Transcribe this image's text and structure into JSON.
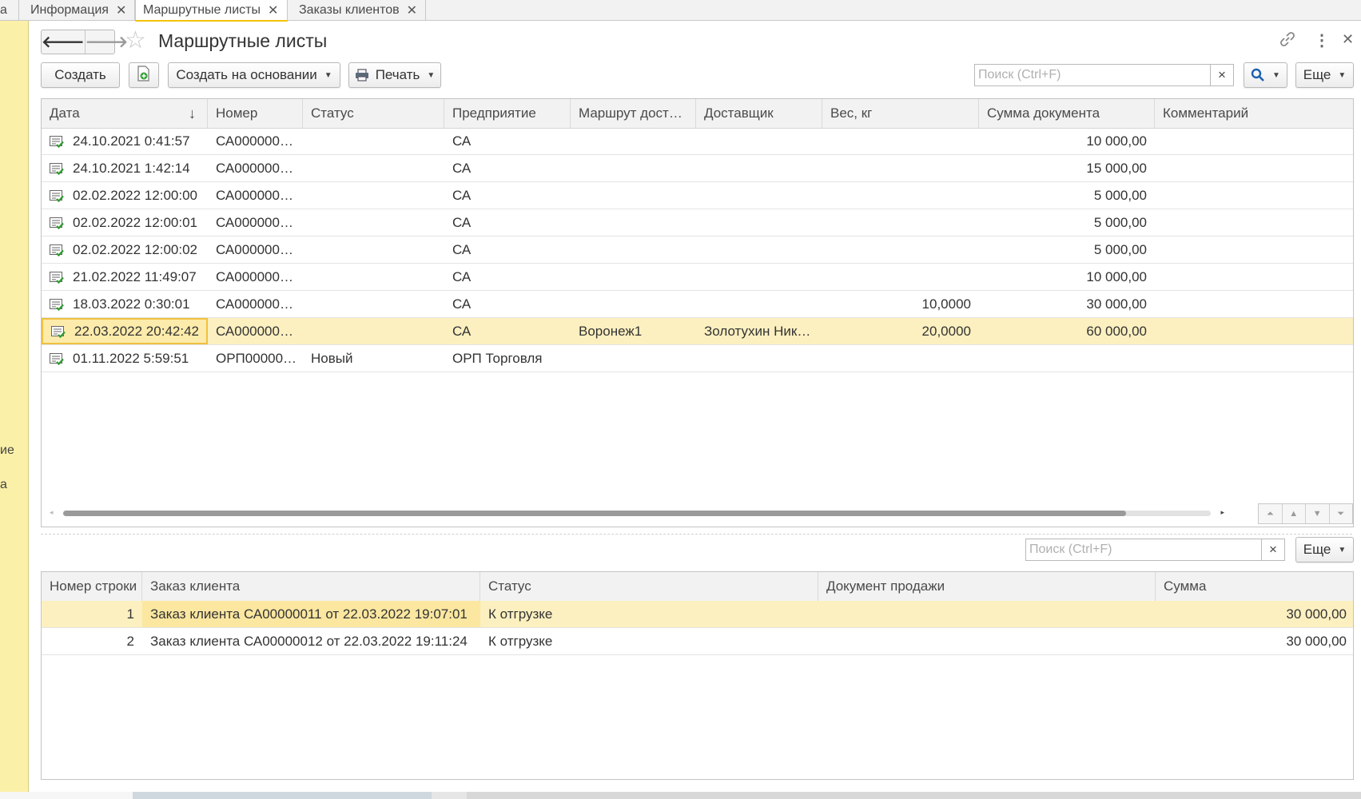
{
  "tabs": [
    {
      "label": "а",
      "closable": false
    },
    {
      "label": "Информация",
      "closable": true
    },
    {
      "label": "Маршрутные листы",
      "closable": true,
      "active": true
    },
    {
      "label": "Заказы клиентов",
      "closable": true
    }
  ],
  "left_panel": {
    "item1": "ие",
    "item2": "а"
  },
  "header": {
    "title": "Маршрутные листы",
    "back_icon": "arrow-left-icon",
    "forward_icon": "arrow-right-icon",
    "favorite_icon": "star-icon",
    "link_icon": "link-icon",
    "menu_icon": "kebab-menu-icon",
    "close_icon": "close-icon"
  },
  "toolbar": {
    "create_label": "Создать",
    "copy_icon": "add-document-icon",
    "create_based_label": "Создать на основании",
    "print_label": "Печать",
    "search_placeholder": "Поиск (Ctrl+F)",
    "search_clear": "×",
    "more_label": "Еще"
  },
  "main_table": {
    "columns": [
      "Дата",
      "Номер",
      "Статус",
      "Предприятие",
      "Маршрут дост…",
      "Доставщик",
      "Вес, кг",
      "Сумма документа",
      "Комментарий"
    ],
    "sort_icon": "↓",
    "rows": [
      {
        "date": "24.10.2021 0:41:57",
        "number": "СА000000…",
        "status": "",
        "company": "СА",
        "route": "",
        "courier": "",
        "weight": "",
        "sum": "10 000,00",
        "comment": ""
      },
      {
        "date": "24.10.2021 1:42:14",
        "number": "СА000000…",
        "status": "",
        "company": "СА",
        "route": "",
        "courier": "",
        "weight": "",
        "sum": "15 000,00",
        "comment": ""
      },
      {
        "date": "02.02.2022 12:00:00",
        "number": "СА000000…",
        "status": "",
        "company": "СА",
        "route": "",
        "courier": "",
        "weight": "",
        "sum": "5 000,00",
        "comment": ""
      },
      {
        "date": "02.02.2022 12:00:01",
        "number": "СА000000…",
        "status": "",
        "company": "СА",
        "route": "",
        "courier": "",
        "weight": "",
        "sum": "5 000,00",
        "comment": ""
      },
      {
        "date": "02.02.2022 12:00:02",
        "number": "СА000000…",
        "status": "",
        "company": "СА",
        "route": "",
        "courier": "",
        "weight": "",
        "sum": "5 000,00",
        "comment": ""
      },
      {
        "date": "21.02.2022 11:49:07",
        "number": "СА000000…",
        "status": "",
        "company": "СА",
        "route": "",
        "courier": "",
        "weight": "",
        "sum": "10 000,00",
        "comment": ""
      },
      {
        "date": "18.03.2022 0:30:01",
        "number": "СА000000…",
        "status": "",
        "company": "СА",
        "route": "",
        "courier": "",
        "weight": "10,0000",
        "sum": "30 000,00",
        "comment": ""
      },
      {
        "date": "22.03.2022 20:42:42",
        "number": "СА000000…",
        "status": "",
        "company": "СА",
        "route": "Воронеж1",
        "courier": "Золотухин Ник…",
        "weight": "20,0000",
        "sum": "60 000,00",
        "comment": "",
        "selected": true
      },
      {
        "date": "01.11.2022 5:59:51",
        "number": "ОРП00000…",
        "status": "Новый",
        "company": "ОРП Торговля",
        "route": "",
        "courier": "",
        "weight": "",
        "sum": "",
        "comment": ""
      }
    ]
  },
  "detail": {
    "search_placeholder": "Поиск (Ctrl+F)",
    "search_clear": "×",
    "more_label": "Еще",
    "columns": [
      "Номер строки",
      "Заказ клиента",
      "Статус",
      "Документ продажи",
      "Сумма"
    ],
    "rows": [
      {
        "n": "1",
        "order": "Заказ клиента СА00000011 от 22.03.2022 19:07:01",
        "status": "К отгрузке",
        "sale_doc": "",
        "sum": "30 000,00",
        "selected": true
      },
      {
        "n": "2",
        "order": "Заказ клиента СА00000012 от 22.03.2022 19:11:24",
        "status": "К отгрузке",
        "sale_doc": "",
        "sum": "30 000,00"
      }
    ]
  }
}
